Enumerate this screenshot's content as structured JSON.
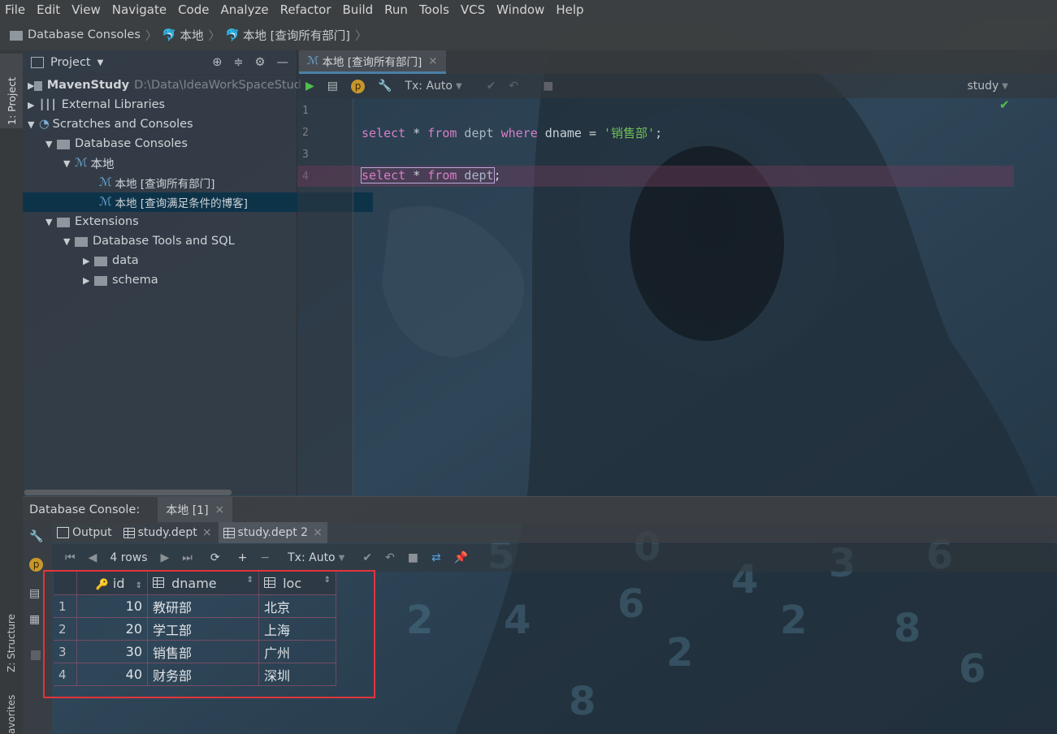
{
  "menu": [
    "File",
    "Edit",
    "View",
    "Navigate",
    "Code",
    "Analyze",
    "Refactor",
    "Build",
    "Run",
    "Tools",
    "VCS",
    "Window",
    "Help"
  ],
  "breadcrumb": [
    "Database Consoles",
    "本地",
    "本地 [查询所有部门]"
  ],
  "tool_stripe": {
    "project": "1: Project",
    "structure": "Z: Structure",
    "favorites": "avorites"
  },
  "project": {
    "title": "Project",
    "tree": [
      {
        "label": "MavenStudy",
        "hint": "D:\\Data\\IdeaWorkSpaceStud"
      },
      {
        "label": "External Libraries"
      },
      {
        "label": "Scratches and Consoles"
      },
      {
        "label": "Database Consoles"
      },
      {
        "label": "本地"
      },
      {
        "label": "本地 [查询所有部门]"
      },
      {
        "label": "本地 [查询满足条件的博客]"
      },
      {
        "label": "Extensions"
      },
      {
        "label": "Database Tools and SQL"
      },
      {
        "label": "data"
      },
      {
        "label": "schema"
      }
    ]
  },
  "editor": {
    "tab": "本地 [查询所有部门]",
    "tx": "Tx: Auto",
    "schema": "study",
    "lines": [
      "1",
      "2",
      "3",
      "4"
    ],
    "line2": {
      "kw1": "select",
      "star": " * ",
      "kw2": "from",
      "tbl": " dept ",
      "kw3": "where",
      "rest": " dname = ",
      "str": "'销售部'",
      "end": ";"
    },
    "line4": {
      "kw1": "select",
      "star": " * ",
      "kw2": "from",
      "tbl": " dept",
      "end": ";"
    }
  },
  "console": {
    "title": "Database Console:",
    "tab": "本地 [1]",
    "tabs": [
      "Output",
      "study.dept",
      "study.dept 2"
    ],
    "rows_label": "4 rows",
    "tx": "Tx: Auto"
  },
  "result": {
    "columns": [
      "id",
      "dname",
      "loc"
    ],
    "rows": [
      {
        "n": "1",
        "id": "10",
        "dname": "教研部",
        "loc": "北京"
      },
      {
        "n": "2",
        "id": "20",
        "dname": "学工部",
        "loc": "上海"
      },
      {
        "n": "3",
        "id": "30",
        "dname": "销售部",
        "loc": "广州"
      },
      {
        "n": "4",
        "id": "40",
        "dname": "财务部",
        "loc": "深圳"
      }
    ]
  },
  "colors": {
    "accent": "#4b7fa6",
    "highlight": "#e2343a",
    "keyword": "#d77ec6",
    "string": "#6fbf5a"
  }
}
